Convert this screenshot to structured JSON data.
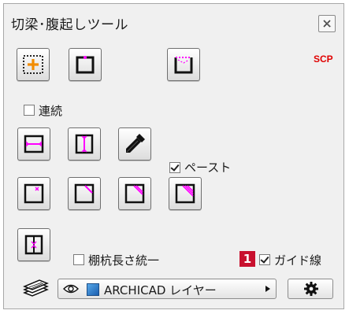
{
  "window": {
    "title": "切梁･腹起しツール"
  },
  "badge_scp": "SCP",
  "options": {
    "continuous_label": "連続",
    "continuous_checked": false,
    "paste_label": "ペースト",
    "paste_checked": true,
    "unify_length_label": "棚杭長さ統一",
    "unify_length_checked": false,
    "guide_line_label": "ガイド線",
    "guide_line_checked": true
  },
  "annotation_marker": "1",
  "layer": {
    "name": "ARCHICAD レイヤー"
  },
  "colors": {
    "accent": "#ff00ff",
    "orange": "#f28c00",
    "scp_red": "#e00000",
    "marker_red": "#c8102e"
  },
  "icons": [
    "add-frame-icon",
    "rectangle-frame-icon",
    "top-dotted-frame-icon",
    "horizontal-brace-icon",
    "vertical-brace-icon",
    "eyedropper-icon",
    "corner-x-icon",
    "corner-diagonal-icon",
    "corner-double-diagonal-icon",
    "corner-triple-diagonal-icon",
    "split-post-icon",
    "layers-icon",
    "eye-icon",
    "layer-color-icon",
    "dropdown-arrow-icon",
    "gear-icon",
    "close-icon"
  ]
}
